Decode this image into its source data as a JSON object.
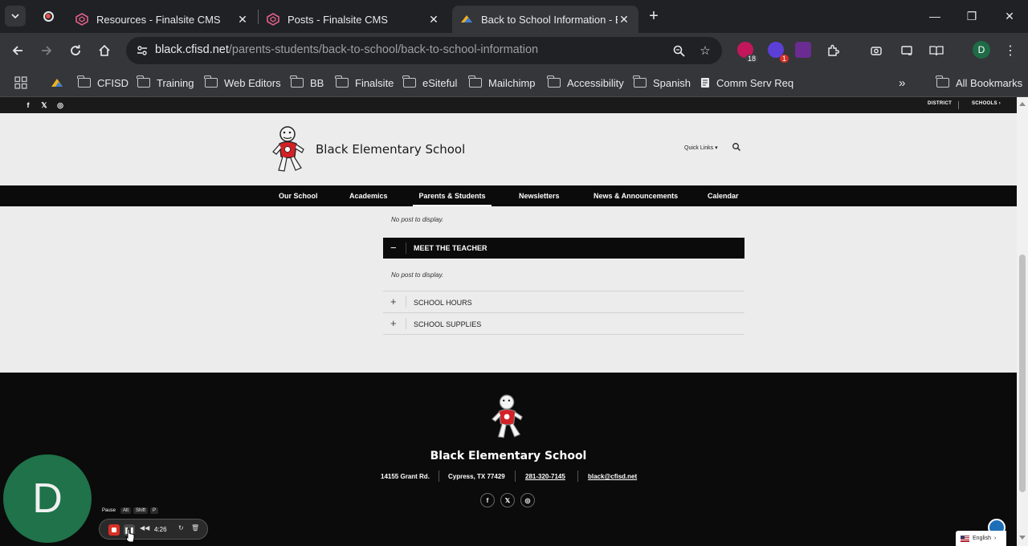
{
  "browser": {
    "tabs": [
      {
        "label": "Resources - Finalsite CMS",
        "active": false
      },
      {
        "label": "Posts - Finalsite CMS",
        "active": false
      },
      {
        "label": "Back to School Information - Bl",
        "active": true
      }
    ],
    "url_host": "black.cfisd.net",
    "url_path": "/parents-students/back-to-school/back-to-school-information",
    "profile_initial": "D",
    "extension_badges": {
      "first": "18",
      "second": "1"
    },
    "bookmarks": [
      "CFISD",
      "Training",
      "Web Editors",
      "BB",
      "Finalsite",
      "eSiteful",
      "Mailchimp",
      "Accessibility",
      "Spanish",
      "Comm Serv Req"
    ],
    "all_bookmarks": "All Bookmarks",
    "overflow": "»"
  },
  "site": {
    "utility": {
      "district": "DISTRICT",
      "schools": "SCHOOLS ›"
    },
    "school_name": "Black Elementary School",
    "quick_links": "Quick Links ▾",
    "nav": [
      "Our School",
      "Academics",
      "Parents & Students",
      "Newsletters",
      "News & Announcements",
      "Calendar"
    ],
    "nav_current": "Parents & Students",
    "content": {
      "no_post_text": "No post to display.",
      "open_section": {
        "symbol": "−",
        "title": "MEET THE TEACHER"
      },
      "sections": [
        {
          "symbol": "+",
          "title": "SCHOOL HOURS"
        },
        {
          "symbol": "+",
          "title": "SCHOOL SUPPLIES"
        }
      ]
    },
    "footer": {
      "school_name": "Black Elementary School",
      "address": "14155 Grant Rd.",
      "city": "Cypress, TX  77429",
      "phone": "281-320-7145",
      "email": "black@cfisd.net"
    },
    "language": "English"
  },
  "recorder": {
    "avatar_initial": "D",
    "hint_action": "Pause",
    "hint_keys": [
      "Alt",
      "Shift",
      "P"
    ],
    "elapsed": "4:26"
  },
  "colors": {
    "chrome_dark": "#202124",
    "chrome_toolbar": "#35363a",
    "site_bg": "#ececec",
    "site_black": "#0b0b0b",
    "recorder_green": "#1f7249",
    "stop_red": "#d93025"
  }
}
